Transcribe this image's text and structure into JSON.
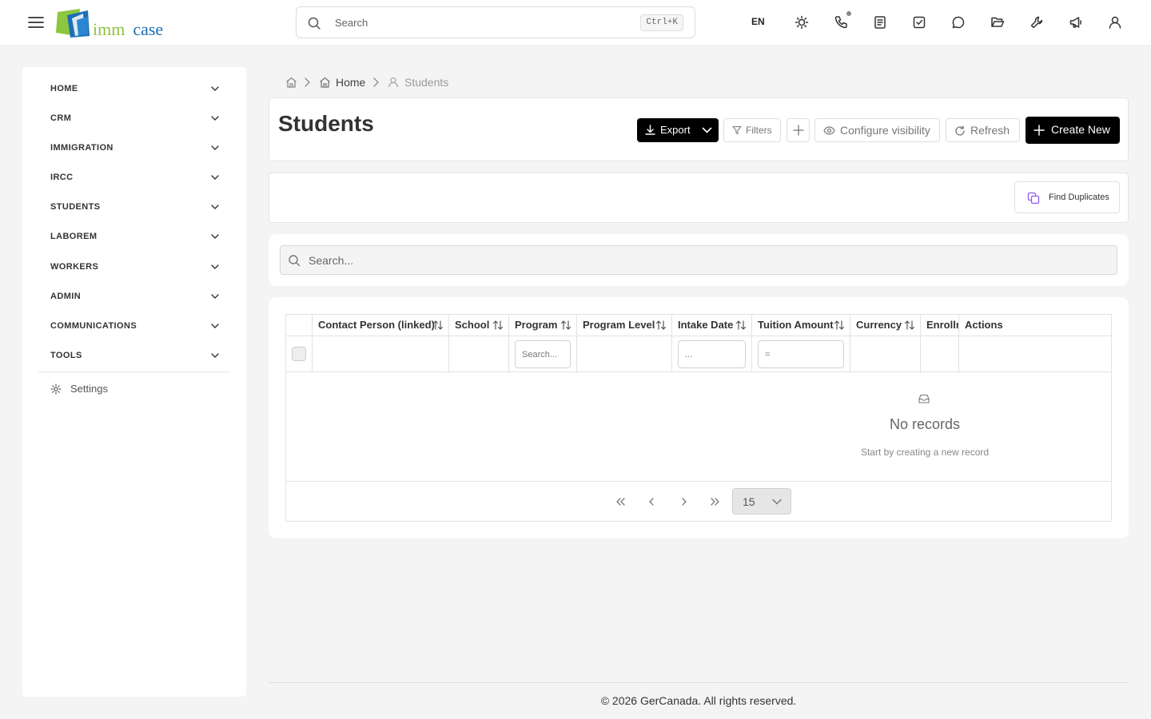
{
  "topbar": {
    "logo": {
      "word1": "imm",
      "word2": "case"
    },
    "search": {
      "placeholder": "Search",
      "shortcut": "Ctrl+K"
    },
    "language": "EN",
    "icons": [
      "theme-sun-icon",
      "phone-icon",
      "notes-icon",
      "tasks-icon",
      "chat-icon",
      "folder-icon",
      "tools-icon",
      "megaphone-icon",
      "user-icon"
    ]
  },
  "sidebar": {
    "items": [
      {
        "label": "HOME"
      },
      {
        "label": "CRM"
      },
      {
        "label": "IMMIGRATION"
      },
      {
        "label": "IRCC"
      },
      {
        "label": "STUDENTS"
      },
      {
        "label": "LABOREM"
      },
      {
        "label": "WORKERS"
      },
      {
        "label": "ADMIN"
      },
      {
        "label": "COMMUNICATIONS"
      },
      {
        "label": "TOOLS"
      }
    ],
    "settings": "Settings"
  },
  "breadcrumb": {
    "home": "Home",
    "current": "Students"
  },
  "page": {
    "title": "Students"
  },
  "toolbar": {
    "export": "Export",
    "filters": "Filters",
    "configure": "Configure visibility",
    "refresh": "Refresh",
    "create": "Create New"
  },
  "duplicates": {
    "label": "Find Duplicates"
  },
  "tableSearch": {
    "placeholder": "Search..."
  },
  "table": {
    "columns": [
      "Contact Person (linked)",
      "School",
      "Program",
      "Program Level",
      "Intake Date",
      "Tuition Amount",
      "Currency",
      "Enrollm",
      "Actions"
    ],
    "filters": {
      "program": "Search...",
      "intake": "...",
      "tuition": "="
    },
    "empty": {
      "title": "No records",
      "subtitle": "Start by creating a new record"
    },
    "pageSize": "15"
  },
  "footer": "© 2026 GerCanada. All rights reserved.",
  "colors": {
    "primary": "#000000",
    "accent": "#8b5cf6",
    "logoGreen": "#8dc63f",
    "logoBlue": "#1e6fb5"
  }
}
